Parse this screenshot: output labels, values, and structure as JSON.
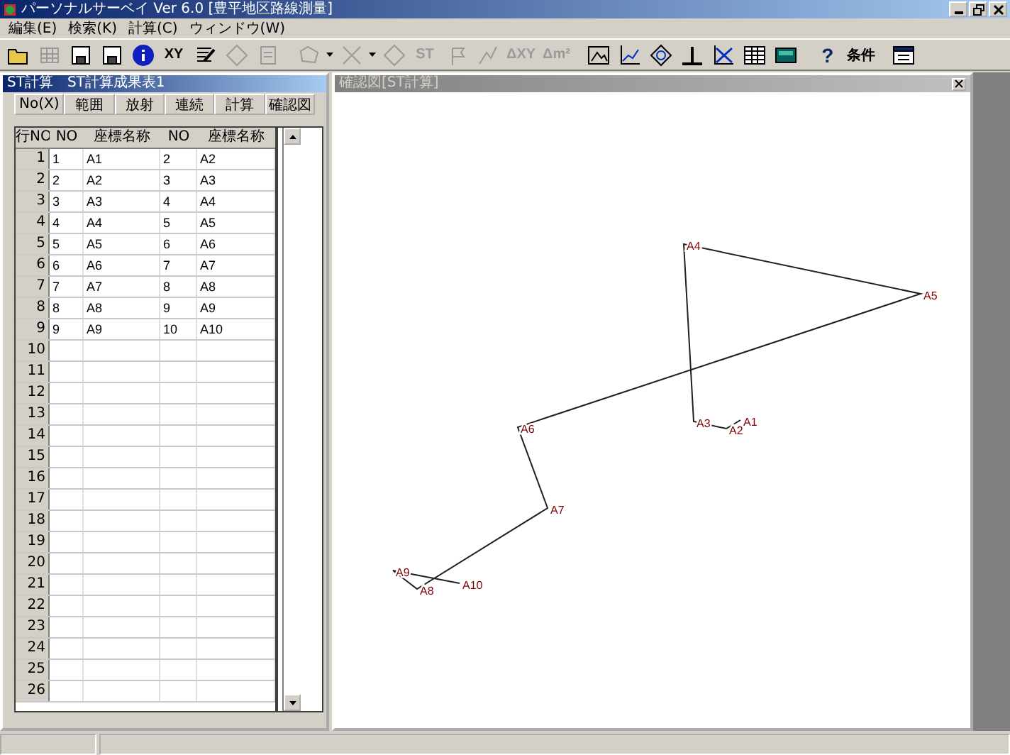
{
  "window": {
    "title": "パーソナルサーベイ Ver 6.0 [豊平地区路線測量]"
  },
  "menu": [
    "編集(E)",
    "検索(K)",
    "計算(C)",
    "ウィンドウ(W)"
  ],
  "toolbar": [
    {
      "label": "XY",
      "disabled": false
    },
    {
      "label": "ST",
      "disabled": true
    },
    {
      "label": "ΔXY",
      "disabled": true
    },
    {
      "label": "Δm²",
      "disabled": true
    },
    {
      "label": "?",
      "disabled": false
    },
    {
      "label": "条件",
      "disabled": false
    }
  ],
  "table_window": {
    "title": "ST計算　ST計算成果表1",
    "buttons": [
      "No(X)",
      "範囲",
      "放射",
      "連続",
      "計算",
      "確認図"
    ],
    "columns": [
      "行NO",
      "NO",
      "座標名称",
      "NO",
      "座標名称"
    ],
    "rows": [
      {
        "row_no": "1",
        "cells": [
          "1",
          "A1",
          "2",
          "A2"
        ]
      },
      {
        "row_no": "2",
        "cells": [
          "2",
          "A2",
          "3",
          "A3"
        ]
      },
      {
        "row_no": "3",
        "cells": [
          "3",
          "A3",
          "4",
          "A4"
        ]
      },
      {
        "row_no": "4",
        "cells": [
          "4",
          "A4",
          "5",
          "A5"
        ]
      },
      {
        "row_no": "5",
        "cells": [
          "5",
          "A5",
          "6",
          "A6"
        ]
      },
      {
        "row_no": "6",
        "cells": [
          "6",
          "A6",
          "7",
          "A7"
        ]
      },
      {
        "row_no": "7",
        "cells": [
          "7",
          "A7",
          "8",
          "A8"
        ]
      },
      {
        "row_no": "8",
        "cells": [
          "8",
          "A8",
          "9",
          "A9"
        ]
      },
      {
        "row_no": "9",
        "cells": [
          "9",
          "A9",
          "10",
          "A10"
        ]
      },
      {
        "row_no": "10"
      },
      {
        "row_no": "11"
      },
      {
        "row_no": "12"
      },
      {
        "row_no": "13"
      },
      {
        "row_no": "14"
      },
      {
        "row_no": "15"
      },
      {
        "row_no": "16"
      },
      {
        "row_no": "17"
      },
      {
        "row_no": "18"
      },
      {
        "row_no": "19"
      },
      {
        "row_no": "20"
      },
      {
        "row_no": "21"
      },
      {
        "row_no": "22"
      },
      {
        "row_no": "23"
      },
      {
        "row_no": "24"
      },
      {
        "row_no": "25"
      },
      {
        "row_no": "26"
      }
    ]
  },
  "diagram_window": {
    "title": "確認図[ST計算]",
    "points": [
      "A1",
      "A2",
      "A3",
      "A4",
      "A5",
      "A6",
      "A7",
      "A8",
      "A9",
      "A10"
    ]
  }
}
